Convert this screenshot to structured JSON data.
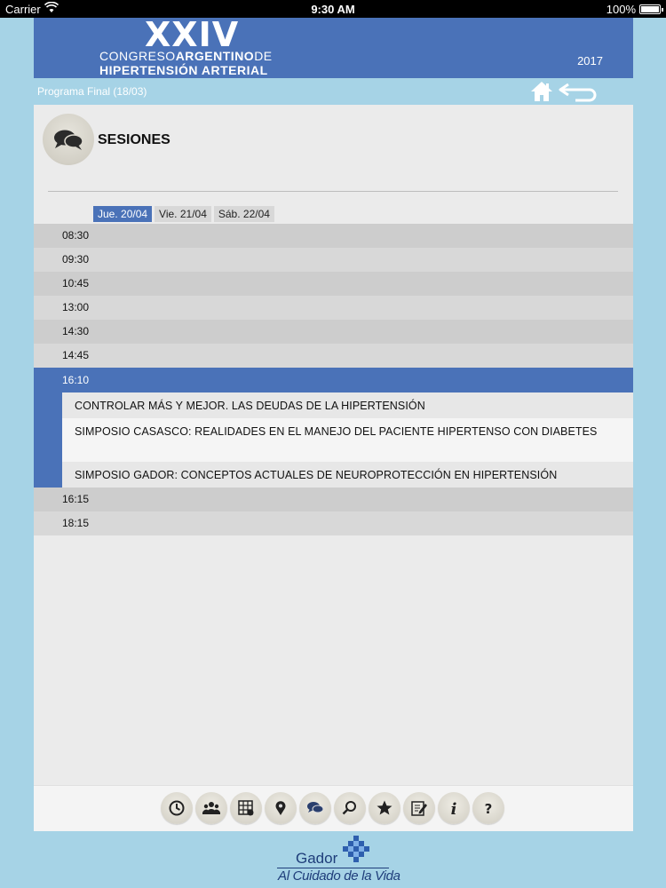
{
  "status_bar": {
    "carrier": "Carrier",
    "time": "9:30 AM",
    "battery": "100%"
  },
  "banner": {
    "roman": "XXIV",
    "line1_a": "CONGRESO",
    "line1_b": "ARGENTINO",
    "line1_c": "DE",
    "line2": "HIPERTENSIÓN ARTERIAL",
    "year": "2017"
  },
  "nav": {
    "breadcrumb": "Programa Final (18/03)",
    "home_icon": "home-icon",
    "back_icon": "back-arrow-icon"
  },
  "section": {
    "title": "SESIONES",
    "icon": "chat-bubbles-icon"
  },
  "day_tabs": [
    {
      "label": "Jue. 20/04",
      "active": true
    },
    {
      "label": "Vie. 21/04",
      "active": false
    },
    {
      "label": "Sáb. 22/04",
      "active": false
    }
  ],
  "time_slots": [
    "08:30",
    "09:30",
    "10:45",
    "13:00",
    "14:30",
    "14:45",
    "16:10",
    "16:15",
    "18:15"
  ],
  "expanded_slot": {
    "time": "16:10",
    "sessions": [
      "CONTROLAR MÁS Y MEJOR. LAS DEUDAS DE LA HIPERTENSIÓN",
      "SIMPOSIO CASASCO: REALIDADES EN EL MANEJO DEL PACIENTE HIPERTENSO CON DIABETES",
      "SIMPOSIO GADOR: CONCEPTOS ACTUALES DE NEUROPROTECCIÓN EN HIPERTENSIÓN"
    ]
  },
  "toolbar_icons": [
    "clock-icon",
    "people-icon",
    "calendar-grid-icon",
    "location-pin-icon",
    "chat-bubbles-icon",
    "search-icon",
    "star-icon",
    "note-edit-icon",
    "info-icon",
    "help-icon"
  ],
  "footer": {
    "brand": "Gador",
    "tagline": "Al Cuidado de la Vida"
  },
  "colors": {
    "accent": "#4a72b8",
    "background": "#a6d3e6",
    "panel": "#ebebeb"
  }
}
